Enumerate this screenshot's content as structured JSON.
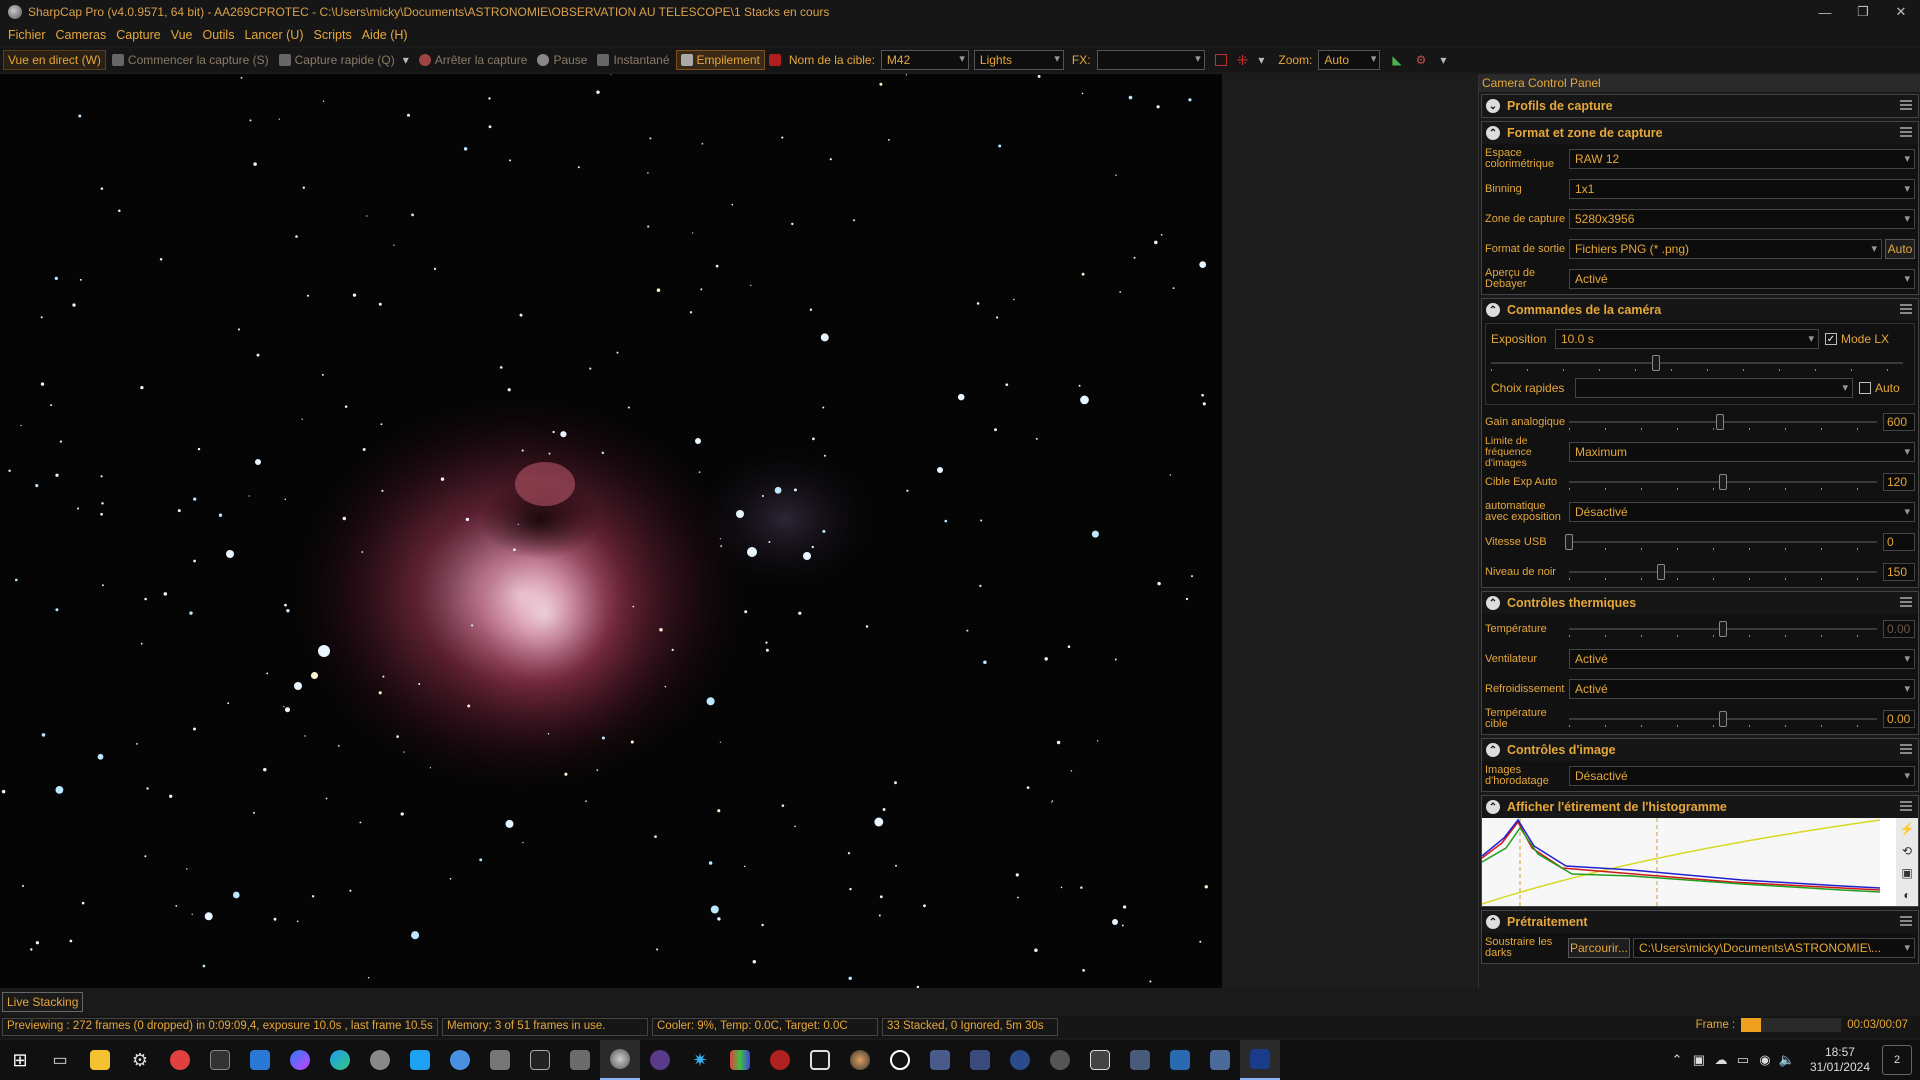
{
  "window": {
    "title": "SharpCap Pro (v4.0.9571, 64 bit) - AA269CPROTEC - C:\\Users\\micky\\Documents\\ASTRONOMIE\\OBSERVATION AU TELESCOPE\\1 Stacks en cours",
    "minimize": "—",
    "restore": "❐",
    "close": "✕"
  },
  "menu": [
    "Fichier",
    "Cameras",
    "Capture",
    "Vue",
    "Outils",
    "Lancer (U)",
    "Scripts",
    "Aide (H)"
  ],
  "toolbar": {
    "live_view": "Vue en direct (W)",
    "start_capture": "Commencer la capture (S)",
    "quick_capture": "Capture rapide (Q)",
    "stop_capture": "Arrêter la capture",
    "pause": "Pause",
    "snapshot": "Instantané",
    "stacking": "Empilement",
    "target_label": "Nom de la cible:",
    "target_value": "M42",
    "frame_type": "Lights",
    "fx_label": "FX:",
    "fx_value": "",
    "zoom_label": "Zoom:",
    "zoom_value": "Auto"
  },
  "panel": {
    "title": "Camera Control Panel",
    "sections": {
      "profiles": "Profils de capture",
      "format": "Format et zone de capture",
      "camera": "Commandes de la caméra",
      "thermal": "Contrôles thermiques",
      "image": "Contrôles d'image",
      "histogram": "Afficher l'étirement de l'histogramme",
      "preprocess": "Prétraitement"
    },
    "format": {
      "colorspace_label": "Espace colorimétrique",
      "colorspace": "RAW 12",
      "binning_label": "Binning",
      "binning": "1x1",
      "zone_label": "Zone de capture",
      "zone": "5280x3956",
      "output_label": "Format de sortie",
      "output": "Fichiers PNG (* .png)",
      "output_auto": "Auto",
      "debayer_label": "Aperçu de Debayer",
      "debayer": "Activé"
    },
    "camera": {
      "exposure_label": "Exposition",
      "exposure": "10.0 s",
      "lx_label": "Mode LX",
      "lx_checked": true,
      "quick_label": "Choix rapides",
      "quick_value": "",
      "auto_label": "Auto",
      "gain_label": "Gain analogique",
      "gain": "600",
      "gain_fraction": 0.49,
      "fps_label": "Limite de fréquence d'images",
      "fps": "Maximum",
      "target_exp_label": "Cible Exp Auto",
      "target_exp": "120",
      "target_exp_fraction": 0.5,
      "autoexp_label": "automatique avec exposition",
      "autoexp": "Désactivé",
      "usb_label": "Vitesse USB",
      "usb": "0",
      "usb_fraction": 0.0,
      "black_label": "Niveau de noir",
      "black": "150",
      "black_fraction": 0.3,
      "exposure_fraction": 0.4
    },
    "thermal": {
      "temp_label": "Température",
      "temp": "0.00",
      "temp_fraction": 0.5,
      "fan_label": "Ventilateur",
      "fan": "Activé",
      "cooling_label": "Refroidissement",
      "cooling": "Activé",
      "target_temp_label": "Température cible",
      "target_temp": "0.00",
      "target_temp_fraction": 0.5
    },
    "image": {
      "timestamp_label": "Images d'horodatage",
      "timestamp": "Désactivé"
    },
    "preprocess": {
      "darks_label": "Soustraire les darks",
      "browse": "Parcourir...",
      "path": "C:\\Users\\micky\\Documents\\ASTRONOMIE\\..."
    }
  },
  "live_tab": "Live Stacking",
  "status": {
    "preview": "Previewing : 272 frames (0 dropped) in 0:09:09,4, exposure 10.0s , last frame 10.5s",
    "memory": "Memory: 3 of 51 frames in use.",
    "cooler": "Cooler: 9%, Temp: 0.0C, Target: 0.0C",
    "stacked": "33 Stacked, 0 Ignored, 5m 30s",
    "frame_label": "Frame :",
    "frame_time": "00:03/00:07",
    "frame_fraction": 0.2
  },
  "taskbar": {
    "time": "18:57",
    "date": "31/01/2024",
    "notifications": "2"
  },
  "colors": {
    "accent": "#e6a73a",
    "background": "#1a1a1a"
  }
}
